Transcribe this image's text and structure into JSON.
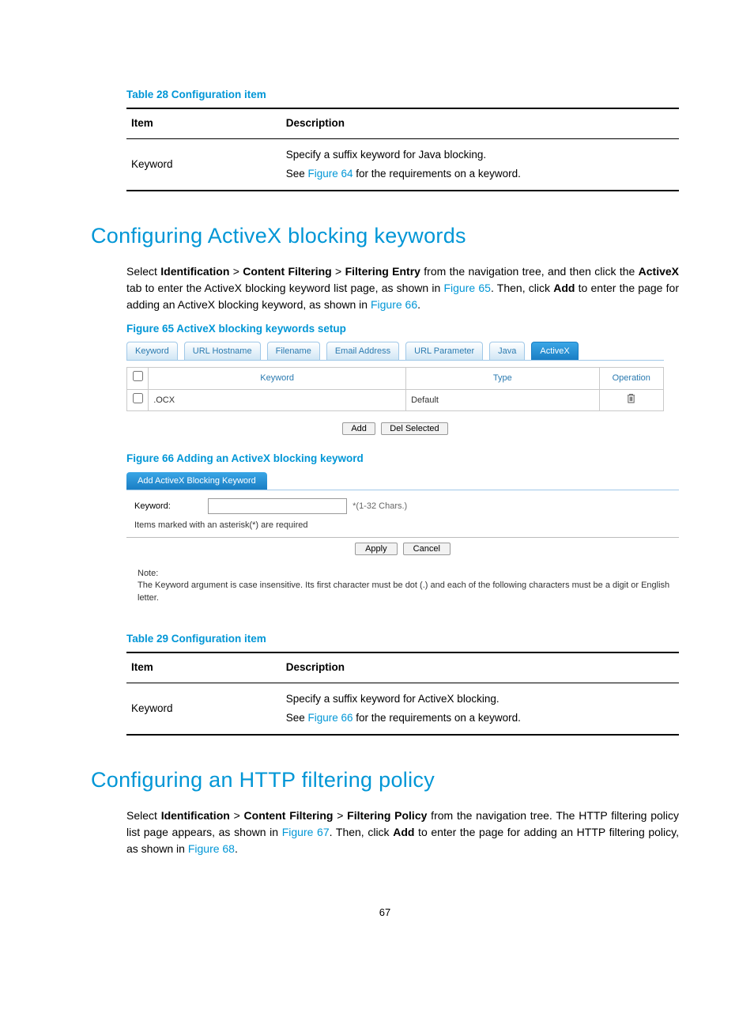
{
  "table28": {
    "caption": "Table 28 Configuration item",
    "head_item": "Item",
    "head_desc": "Description",
    "row_item": "Keyword",
    "row_line1": "Specify a suffix keyword for Java blocking.",
    "row_line2a": "See ",
    "row_line2_link": "Figure 64",
    "row_line2b": " for the requirements on a keyword."
  },
  "section1": {
    "title": "Configuring ActiveX blocking keywords",
    "p1a": "Select ",
    "b_identification": "Identification",
    "gt": " > ",
    "b_cf": "Content Filtering",
    "b_fe": "Filtering Entry",
    "p1b": " from the navigation tree, and then click the ",
    "b_activex": "ActiveX",
    "p1c": " tab to enter the ActiveX blocking keyword list page, as shown in ",
    "link_fig65": "Figure 65",
    "p1d": ". Then, click ",
    "b_add": "Add",
    "p1e": " to enter the page for adding an ActiveX blocking keyword, as shown in ",
    "link_fig66": "Figure 66",
    "p1f": "."
  },
  "fig65": {
    "caption": "Figure 65 ActiveX blocking keywords setup",
    "tabs": [
      "Keyword",
      "URL Hostname",
      "Filename",
      "Email Address",
      "URL Parameter",
      "Java",
      "ActiveX"
    ],
    "active_tab_index": 6,
    "col_keyword": "Keyword",
    "col_type": "Type",
    "col_op": "Operation",
    "row_keyword": ".OCX",
    "row_type": "Default",
    "btn_add": "Add",
    "btn_del": "Del Selected"
  },
  "fig66": {
    "caption": "Figure 66 Adding an ActiveX blocking keyword",
    "bar": "Add ActiveX Blocking Keyword",
    "label_keyword": "Keyword:",
    "hint": "*(1-32 Chars.)",
    "required": "Items marked with an asterisk(*) are required",
    "btn_apply": "Apply",
    "btn_cancel": "Cancel",
    "note_label": "Note:",
    "note_body": "The Keyword argument is case insensitive. Its first character must be dot (.) and each of the following characters must be a digit or English letter."
  },
  "table29": {
    "caption": "Table 29 Configuration item",
    "head_item": "Item",
    "head_desc": "Description",
    "row_item": "Keyword",
    "row_line1": "Specify a suffix keyword for ActiveX blocking.",
    "row_line2a": "See ",
    "row_line2_link": "Figure 66",
    "row_line2b": " for the requirements on a keyword."
  },
  "section2": {
    "title": "Configuring an HTTP filtering policy",
    "p1a": "Select ",
    "b_identification": "Identification",
    "gt": " > ",
    "b_cf": "Content Filtering",
    "b_fp": "Filtering Policy",
    "p1b": " from the navigation tree. The HTTP filtering policy list page appears, as shown in ",
    "link_fig67": "Figure 67",
    "p1c": ". Then, click ",
    "b_add": "Add",
    "p1d": " to enter the page for adding an HTTP filtering policy, as shown in ",
    "link_fig68": "Figure 68",
    "p1e": "."
  },
  "page_number": "67"
}
